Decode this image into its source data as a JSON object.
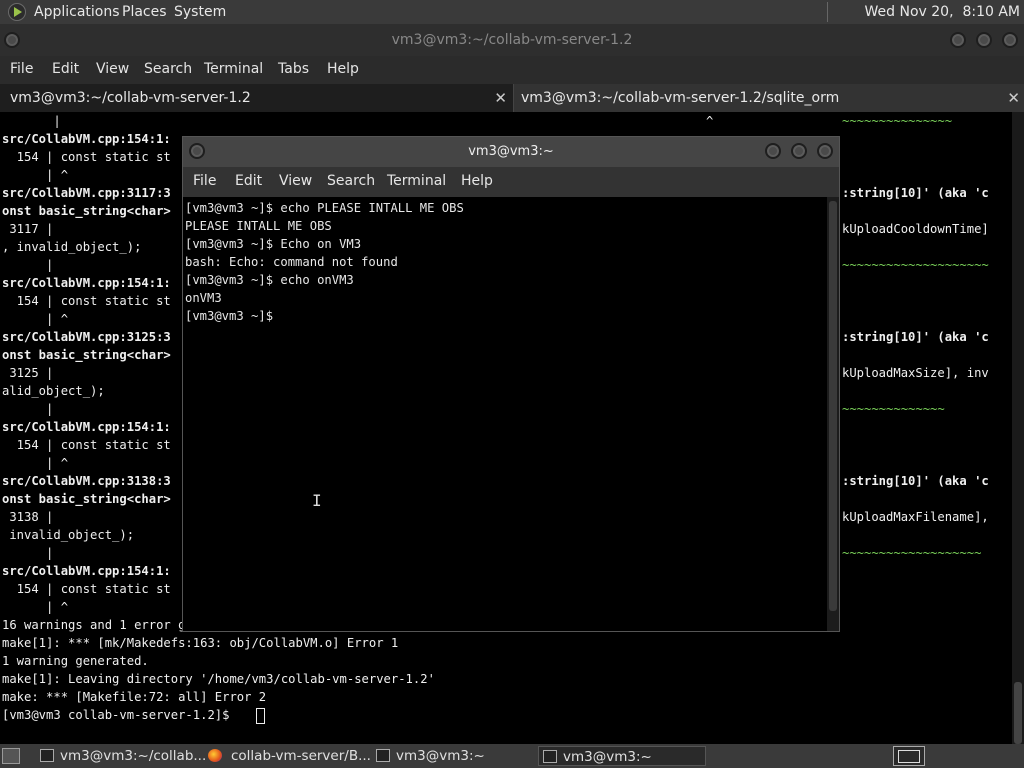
{
  "top_panel": {
    "menus": [
      "Applications",
      "Places",
      "System"
    ],
    "clock": "Wed Nov 20,  8:10 AM"
  },
  "main_window": {
    "title": "vm3@vm3:~/collab-vm-server-1.2",
    "menu": [
      "File",
      "Edit",
      "View",
      "Search",
      "Terminal",
      "Tabs",
      "Help"
    ],
    "tabs": [
      {
        "label": "vm3@vm3:~/collab-vm-server-1.2"
      },
      {
        "label": "vm3@vm3:~/collab-vm-server-1.2/sqlite_orm"
      }
    ],
    "left_lines": [
      "       |",
      "src/CollabVM.cpp:154:1:",
      "  154 | const static st",
      "      | ^",
      "src/CollabVM.cpp:3117:3",
      "onst basic_string<char>",
      " 3117 |",
      ", invalid_object_);",
      "      |",
      "src/CollabVM.cpp:154:1:",
      "  154 | const static st",
      "      | ^",
      "src/CollabVM.cpp:3125:3",
      "onst basic_string<char>",
      " 3125 |",
      "alid_object_);",
      "      |",
      "src/CollabVM.cpp:154:1:",
      "  154 | const static st",
      "      | ^",
      "src/CollabVM.cpp:3138:3",
      "onst basic_string<char>",
      " 3138 |",
      " invalid_object_);",
      "      |",
      "src/CollabVM.cpp:154:1:",
      "  154 | const static st",
      "      | ^",
      "16 warnings and 1 error generated.",
      "make[1]: *** [mk/Makedefs:163: obj/CollabVM.o] Error 1",
      "1 warning generated.",
      "make[1]: Leaving directory '/home/vm3/collab-vm-server-1.2'",
      "make: *** [Makefile:72: all] Error 2",
      "[vm3@vm3 collab-vm-server-1.2]$ "
    ],
    "right_fragments": [
      {
        "text": "~~~~~~~~~~~~~~~",
        "style": "green"
      },
      {
        "text": ":string[10]' (aka 'c",
        "style": "bold"
      },
      {
        "text": "kUploadCooldownTime]",
        "style": "normal"
      },
      {
        "text": "~~~~~~~~~~~~~~~~~~~~",
        "style": "green"
      },
      {
        "text": ":string[10]' (aka 'c",
        "style": "bold"
      },
      {
        "text": "kUploadMaxSize], inv",
        "style": "normal"
      },
      {
        "text": "~~~~~~~~~~~~~~",
        "style": "green"
      },
      {
        "text": ":string[10]' (aka 'c",
        "style": "bold"
      },
      {
        "text": "kUploadMaxFilename],",
        "style": "normal"
      },
      {
        "text": "~~~~~~~~~~~~~~~~~~~",
        "style": "green"
      }
    ],
    "caret_glyph": "^"
  },
  "overlay_window": {
    "title": "vm3@vm3:~",
    "menu": [
      "File",
      "Edit",
      "View",
      "Search",
      "Terminal",
      "Help"
    ],
    "lines": [
      "[vm3@vm3 ~]$ echo PLEASE INTALL ME OBS",
      "PLEASE INTALL ME OBS",
      "[vm3@vm3 ~]$ Echo on VM3",
      "bash: Echo: command not found",
      "[vm3@vm3 ~]$ echo onVM3",
      "onVM3",
      "[vm3@vm3 ~]$ "
    ]
  },
  "taskbar": {
    "tasks": [
      {
        "label": "vm3@vm3:~/collab...",
        "icon": "terminal-icon",
        "active": false
      },
      {
        "label": "collab-vm-server/B...",
        "icon": "firefox-icon",
        "active": false
      },
      {
        "label": "vm3@vm3:~",
        "icon": "terminal-icon",
        "active": false
      },
      {
        "label": "vm3@vm3:~",
        "icon": "terminal-icon",
        "active": true
      }
    ]
  }
}
